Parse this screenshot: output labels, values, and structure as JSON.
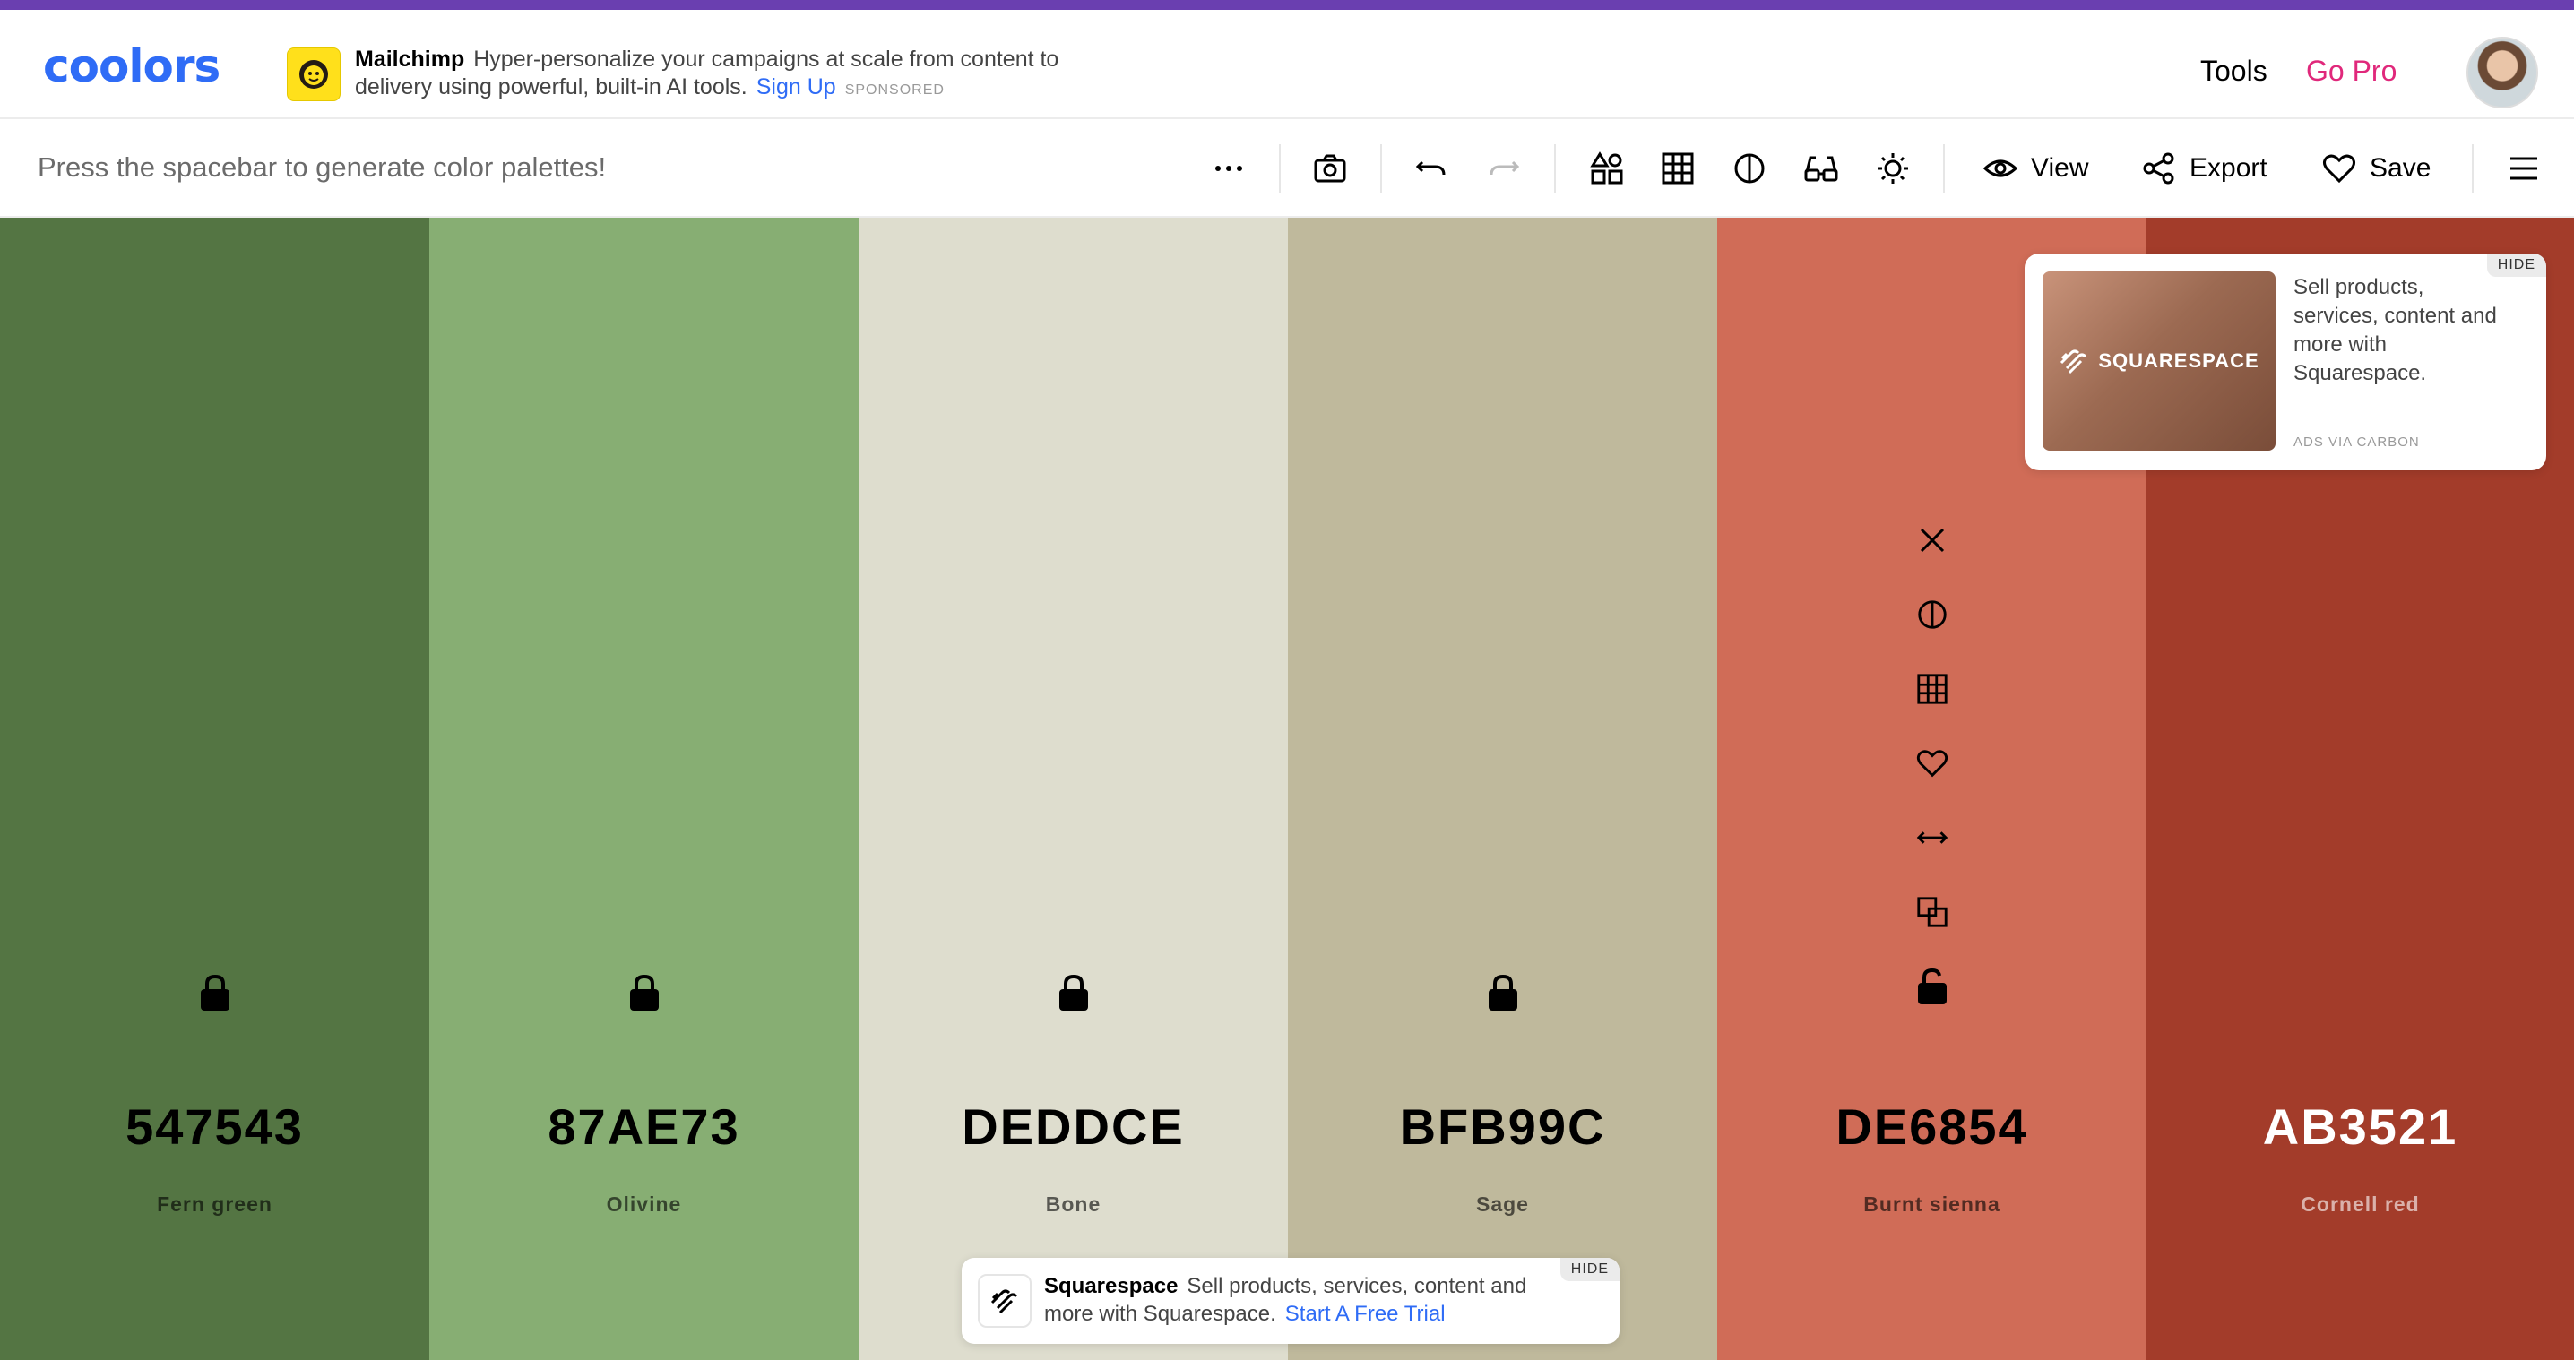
{
  "app": {
    "logo_text": "coolors"
  },
  "sponsor": {
    "brand": "Mailchimp",
    "text": "Hyper-personalize your campaigns at scale from content to delivery using powerful, built-in AI tools.",
    "link": "Sign Up",
    "tag": "SPONSORED",
    "icon": "mailchimp-logo"
  },
  "nav": {
    "tools": "Tools",
    "go_pro": "Go Pro"
  },
  "toolbar": {
    "hint": "Press the spacebar to generate color palettes!",
    "view_label": "View",
    "export_label": "Export",
    "save_label": "Save"
  },
  "colors": {
    "accent_bar": "#6a3fb0",
    "logo": "#2f6cf6",
    "go_pro": "#e0287b"
  },
  "palette": [
    {
      "hex": "547543",
      "name": "Fern green",
      "color": "#547543",
      "text_color": "#000000",
      "locked": true
    },
    {
      "hex": "87AE73",
      "name": "Olivine",
      "color": "#87AE73",
      "text_color": "#000000",
      "locked": true
    },
    {
      "hex": "DEDDCE",
      "name": "Bone",
      "color": "#DEDDCE",
      "text_color": "#000000",
      "locked": true
    },
    {
      "hex": "BFB99C",
      "name": "Sage",
      "color": "#BFB99C",
      "text_color": "#000000",
      "locked": true
    },
    {
      "hex": "DE6854",
      "name": "Burnt sienna",
      "color": "#D06C57",
      "text_color": "#000000",
      "locked": false
    },
    {
      "hex": "AB3521",
      "name": "Cornell red",
      "color": "#A33C2A",
      "text_color": "#ffffff",
      "locked": false
    }
  ],
  "carbon_ad": {
    "image_brand": "SQUARESPACE",
    "text": "Sell products, services, content and more with Squarespace.",
    "via": "ADS VIA CARBON",
    "hide": "HIDE"
  },
  "bottom_ad": {
    "brand": "Squarespace",
    "text": "Sell products, services, content and more with Squarespace.",
    "link": "Start A Free Trial",
    "hide": "HIDE"
  }
}
